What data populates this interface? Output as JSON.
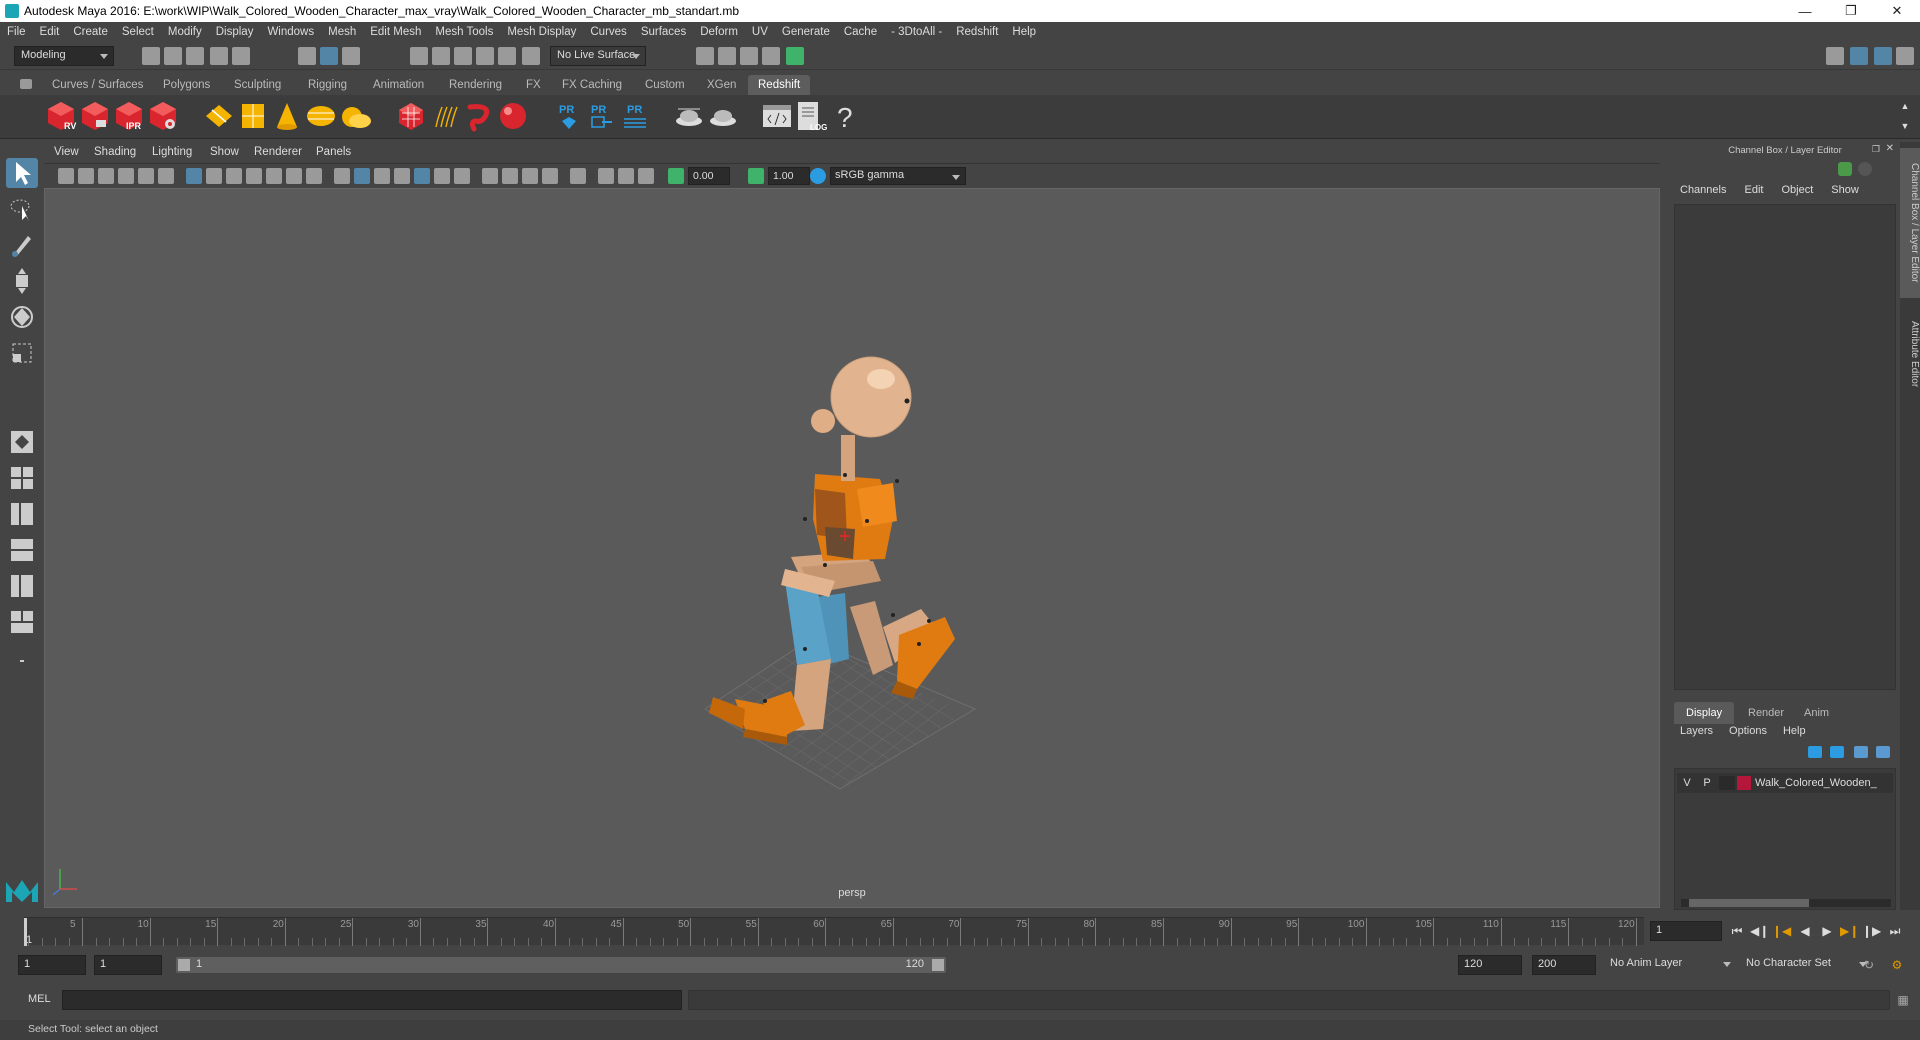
{
  "window": {
    "title": "Autodesk Maya 2016: E:\\work\\WIP\\Walk_Colored_Wooden_Character_max_vray\\Walk_Colored_Wooden_Character_mb_standart.mb"
  },
  "menubar": [
    "File",
    "Edit",
    "Create",
    "Select",
    "Modify",
    "Display",
    "Windows",
    "Mesh",
    "Edit Mesh",
    "Mesh Tools",
    "Mesh Display",
    "Curves",
    "Surfaces",
    "Deform",
    "UV",
    "Generate",
    "Cache",
    "- 3DtoAll -",
    "Redshift",
    "Help"
  ],
  "statusline": {
    "mode": "Modeling",
    "live_surface": "No Live Surface"
  },
  "shelf_tabs": [
    "Curves / Surfaces",
    "Polygons",
    "Sculpting",
    "Rigging",
    "Animation",
    "Rendering",
    "FX",
    "FX Caching",
    "Custom",
    "XGen",
    "Redshift"
  ],
  "shelf_active": "Redshift",
  "shelf_icon_labels": {
    "rv": "RV",
    "ipr": "IPR",
    "pr": "PR",
    "log": "LOG",
    "help": "?"
  },
  "viewport_menu": [
    "View",
    "Shading",
    "Lighting",
    "Show",
    "Renderer",
    "Panels"
  ],
  "viewport_tools": {
    "exposure": "0.00",
    "gamma": "1.00",
    "colorspace": "sRGB gamma"
  },
  "viewport_label": "persp",
  "channel_box": {
    "title": "Channel Box / Layer Editor",
    "menu": [
      "Channels",
      "Edit",
      "Object",
      "Show"
    ]
  },
  "layer_editor": {
    "tabs": [
      "Display",
      "Render",
      "Anim"
    ],
    "active_tab": "Display",
    "menu": [
      "Layers",
      "Options",
      "Help"
    ],
    "layers": [
      {
        "v": "V",
        "p": "P",
        "name": "Walk_Colored_Wooden_",
        "color": "#b5173a"
      }
    ]
  },
  "side_tabs": [
    "Channel Box / Layer Editor",
    "Attribute Editor"
  ],
  "timeline": {
    "start": 1,
    "end": 120,
    "ticks": [
      "5",
      "10",
      "15",
      "20",
      "25",
      "30",
      "35",
      "40",
      "45",
      "50",
      "55",
      "60",
      "65",
      "70",
      "75",
      "80",
      "85",
      "90",
      "95",
      "100",
      "105",
      "110",
      "115",
      "120"
    ],
    "current_label": "1",
    "current_frame": "1"
  },
  "range": {
    "start": "1",
    "playback_start": "1",
    "slider_start": "1",
    "slider_end": "120",
    "playback_end": "120",
    "end": "200",
    "anim_layer": "No Anim Layer",
    "character_set": "No Character Set"
  },
  "cmdline": {
    "label": "MEL"
  },
  "helpline": {
    "text": "Select Tool: select an object"
  },
  "colors": {
    "accent": "#5285a6",
    "viewport": "#5a5a5a",
    "panel": "#444444"
  }
}
